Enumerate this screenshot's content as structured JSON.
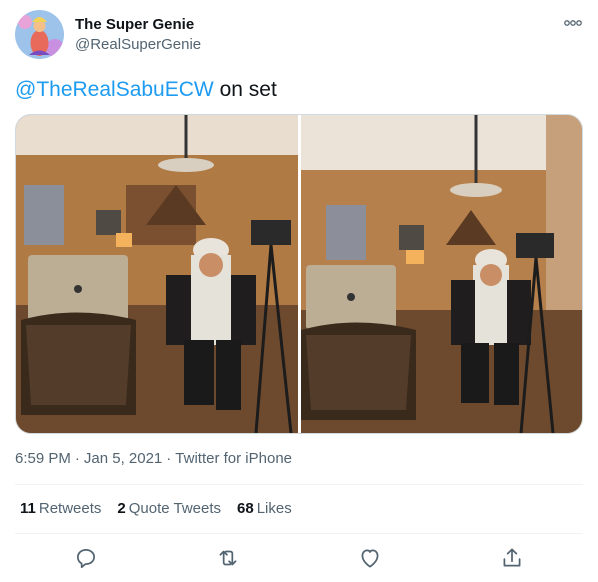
{
  "author": {
    "name": "The Super Genie",
    "handle": "@RealSuperGenie",
    "avatar_icon": "genie-avatar"
  },
  "tweet": {
    "mention": "@TheRealSabuECW",
    "text_rest": " on set"
  },
  "media": [
    {
      "alt": "Man in keffiyeh and track jacket seated on chair next to laptop in living room film set"
    },
    {
      "alt": "Same scene photographed from a slightly different angle"
    }
  ],
  "meta": {
    "time": "6:59 PM",
    "dot1": "·",
    "date": "Jan 5, 2021",
    "dot2": "·",
    "source": "Twitter for iPhone"
  },
  "stats": {
    "retweets_count": "11",
    "retweets_label": "Retweets",
    "quotes_count": "2",
    "quotes_label": "Quote Tweets",
    "likes_count": "68",
    "likes_label": "Likes"
  },
  "actions": {
    "reply_icon": "reply-icon",
    "retweet_icon": "retweet-icon",
    "like_icon": "heart-icon",
    "share_icon": "share-icon"
  },
  "colors": {
    "link": "#1d9bf0",
    "secondary_text": "#536471",
    "divider": "#eff3f4"
  }
}
